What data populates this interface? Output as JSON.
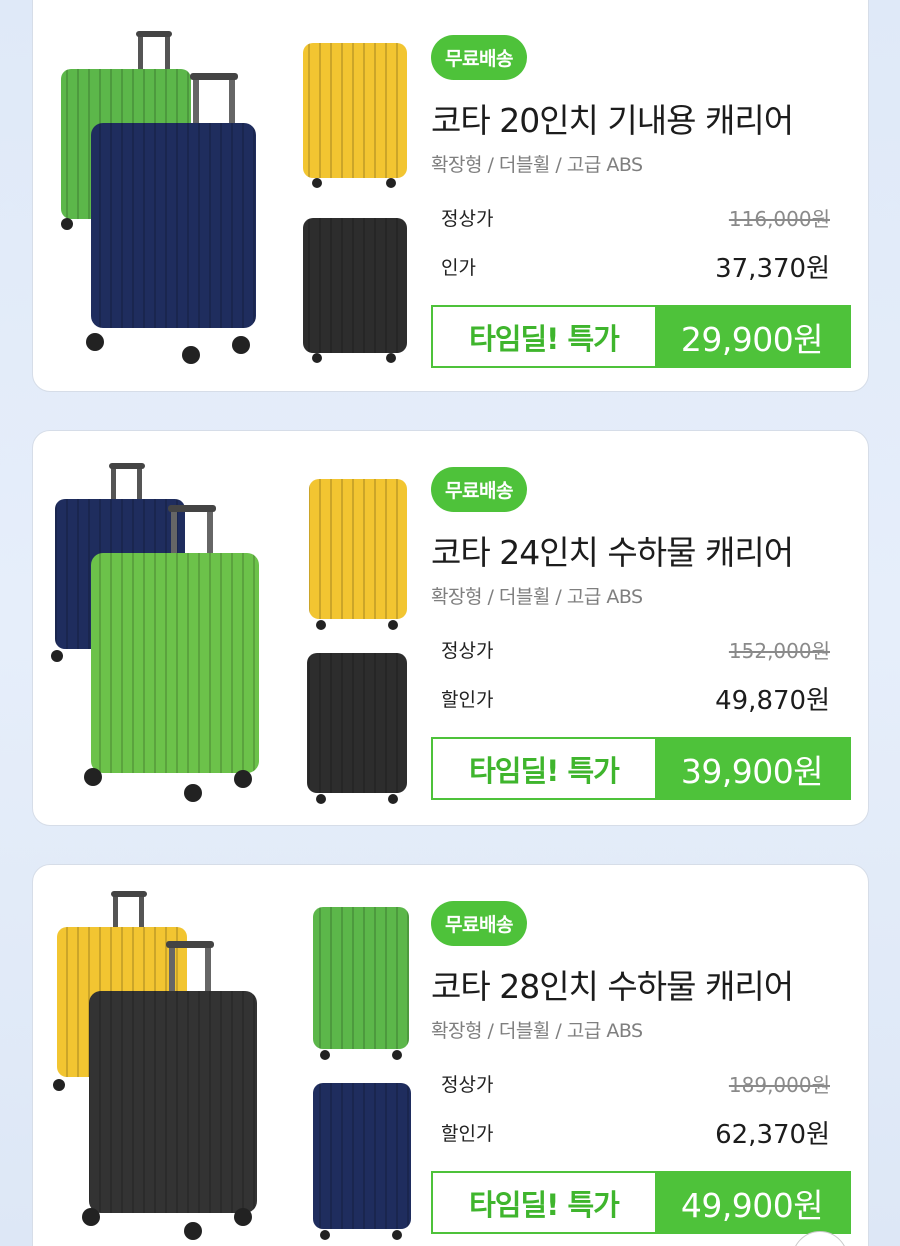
{
  "products": [
    {
      "badge": "무료배송",
      "title": "코타 20인치 기내용 캐리어",
      "spec": "확장형 / 더블휠 / 고급 ABS",
      "regular_label": "정상가",
      "regular_price": "116,000원",
      "sale_label": "인가",
      "sale_price": "37,370원",
      "deal_label": "타임딜! 특가",
      "deal_price": "29,900원",
      "colors": {
        "back": "#5cb74a",
        "front": "#1f2d5e",
        "top": "#f2c531",
        "bottom": "#2d2d2d"
      }
    },
    {
      "badge": "무료배송",
      "title": "코타 24인치 수하물 캐리어",
      "spec": "확장형 / 더블휠 / 고급 ABS",
      "regular_label": "정상가",
      "regular_price": "152,000원",
      "sale_label": "할인가",
      "sale_price": "49,870원",
      "deal_label": "타임딜! 특가",
      "deal_price": "39,900원",
      "colors": {
        "back": "#1f2d5e",
        "front": "#6cc24a",
        "top": "#f2c531",
        "bottom": "#2d2d2d"
      }
    },
    {
      "badge": "무료배송",
      "title": "코타 28인치 수하물 캐리어",
      "spec": "확장형 / 더블휠 / 고급 ABS",
      "regular_label": "정상가",
      "regular_price": "189,000원",
      "sale_label": "할인가",
      "sale_price": "62,370원",
      "deal_label": "타임딜! 특가",
      "deal_price": "49,900원",
      "colors": {
        "back": "#f2c531",
        "front": "#333333",
        "top": "#5cb74a",
        "bottom": "#1f2d5e"
      }
    }
  ]
}
